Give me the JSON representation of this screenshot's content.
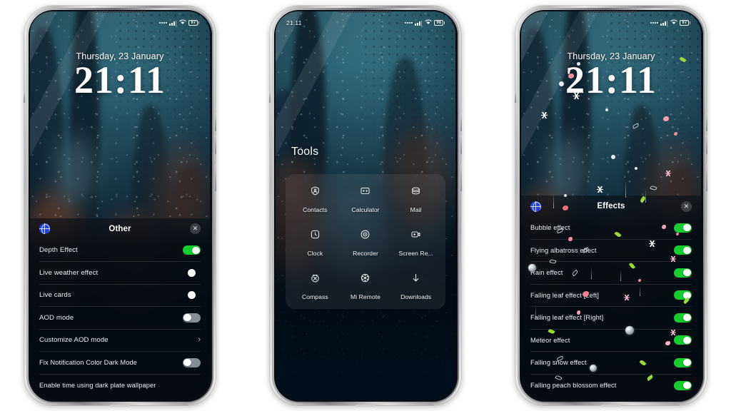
{
  "app": {
    "title": "Lock screen theme customization"
  },
  "phones": [
    {
      "id": "phone-left",
      "status": {
        "time": "",
        "battery": "97",
        "signal_icon": "signal-bars-icon",
        "wifi_icon": "wifi-icon",
        "dots_icon": "signal-dots-icon",
        "battery_icon": "battery-icon"
      },
      "lock": {
        "date": "Thursday, 23 January",
        "time": "21:11"
      },
      "panel": {
        "title": "Other",
        "globe_icon": "globe-icon",
        "close_icon": "close-icon",
        "rows": [
          {
            "label": "Depth Effect",
            "control": "toggle",
            "state": "on"
          },
          {
            "label": "Live weather effect",
            "control": "toggle",
            "state": "bare"
          },
          {
            "label": "Live cards",
            "control": "toggle",
            "state": "bare"
          },
          {
            "label": "AOD mode",
            "control": "toggle",
            "state": "off"
          },
          {
            "label": "Customize AOD mode",
            "control": "chevron",
            "state": ""
          },
          {
            "label": "Fix Notification Color Dark Mode",
            "control": "toggle",
            "state": "off"
          },
          {
            "label": "Enable time using dark plate wallpaper",
            "control": "none",
            "state": ""
          }
        ]
      }
    },
    {
      "id": "phone-center",
      "status": {
        "time": "21.11",
        "battery": "96",
        "signal_icon": "signal-bars-icon",
        "wifi_icon": "wifi-icon",
        "dots_icon": "signal-dots-icon",
        "battery_icon": "battery-icon"
      },
      "tools": {
        "heading": "Tools",
        "items": [
          {
            "label": "Contacts",
            "icon": "contacts-icon"
          },
          {
            "label": "Calculator",
            "icon": "calculator-icon"
          },
          {
            "label": "Mail",
            "icon": "mail-icon"
          },
          {
            "label": "Clock",
            "icon": "clock-icon"
          },
          {
            "label": "Recorder",
            "icon": "recorder-icon"
          },
          {
            "label": "Screen Re...",
            "icon": "screen-recorder-icon"
          },
          {
            "label": "Compass",
            "icon": "compass-icon"
          },
          {
            "label": "Mi Remote",
            "icon": "mi-remote-icon"
          },
          {
            "label": "Downloads",
            "icon": "downloads-icon"
          }
        ]
      }
    },
    {
      "id": "phone-right",
      "status": {
        "time": "",
        "battery": "97",
        "signal_icon": "signal-bars-icon",
        "wifi_icon": "wifi-icon",
        "dots_icon": "signal-dots-icon",
        "battery_icon": "battery-icon"
      },
      "lock": {
        "date": "Thursday, 23 January",
        "time": "21:11"
      },
      "panel": {
        "title": "Effects",
        "globe_icon": "globe-icon",
        "close_icon": "close-icon",
        "rows": [
          {
            "label": "Bubble effect",
            "control": "toggle",
            "state": "on"
          },
          {
            "label": "Flying albatross effect",
            "control": "toggle",
            "state": "on"
          },
          {
            "label": "Rain effect",
            "control": "toggle",
            "state": "on"
          },
          {
            "label": "Falling leaf effect [Left]",
            "control": "toggle",
            "state": "on"
          },
          {
            "label": "Falling leaf effect [Right]",
            "control": "toggle",
            "state": "on"
          },
          {
            "label": "Meteor effect",
            "control": "toggle",
            "state": "on"
          },
          {
            "label": "Falling snow effect",
            "control": "toggle",
            "state": "on"
          },
          {
            "label": "Falling peach blossom effect",
            "control": "toggle",
            "state": "on"
          }
        ]
      }
    }
  ],
  "colors": {
    "toggle_on": "#12cf2f",
    "toggle_off": "#b0bac3",
    "globe_blue": "#2240e8",
    "page_background": "#ffffff",
    "panel_text": "#e8eef3",
    "wallpaper_teal": "#2d6274",
    "leaf_green": "#9ad938",
    "petal_pink": "#f4909d"
  }
}
